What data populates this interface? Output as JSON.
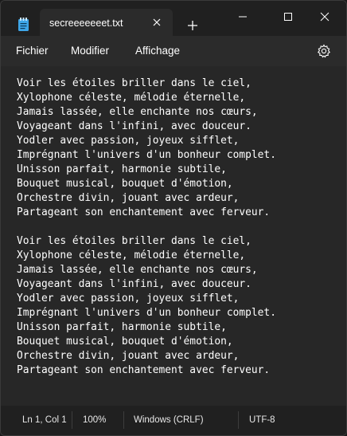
{
  "window": {
    "tab_title": "secreeeeeeet.txt"
  },
  "menu": {
    "file": "Fichier",
    "edit": "Modifier",
    "view": "Affichage"
  },
  "document": {
    "lines": [
      "Voir les étoiles briller dans le ciel,",
      "Xylophone céleste, mélodie éternelle,",
      "Jamais lassée, elle enchante nos cœurs,",
      "Voyageant dans l'infini, avec douceur.",
      "Yodler avec passion, joyeux sifflet,",
      "Imprégnant l'univers d'un bonheur complet.",
      "Unisson parfait, harmonie subtile,",
      "Bouquet musical, bouquet d'émotion,",
      "Orchestre divin, jouant avec ardeur,",
      "Partageant son enchantement avec ferveur.",
      "",
      "Voir les étoiles briller dans le ciel,",
      "Xylophone céleste, mélodie éternelle,",
      "Jamais lassée, elle enchante nos cœurs,",
      "Voyageant dans l'infini, avec douceur.",
      "Yodler avec passion, joyeux sifflet,",
      "Imprégnant l'univers d'un bonheur complet.",
      "Unisson parfait, harmonie subtile,",
      "Bouquet musical, bouquet d'émotion,",
      "Orchestre divin, jouant avec ardeur,",
      "Partageant son enchantement avec ferveur."
    ]
  },
  "status": {
    "position": "Ln 1, Col 1",
    "zoom": "100%",
    "line_endings": "Windows (CRLF)",
    "encoding": "UTF-8"
  },
  "colors": {
    "background": "#202020",
    "editor_background": "#272727",
    "text": "#ffffff",
    "app_icon": "#3ea6e8"
  }
}
